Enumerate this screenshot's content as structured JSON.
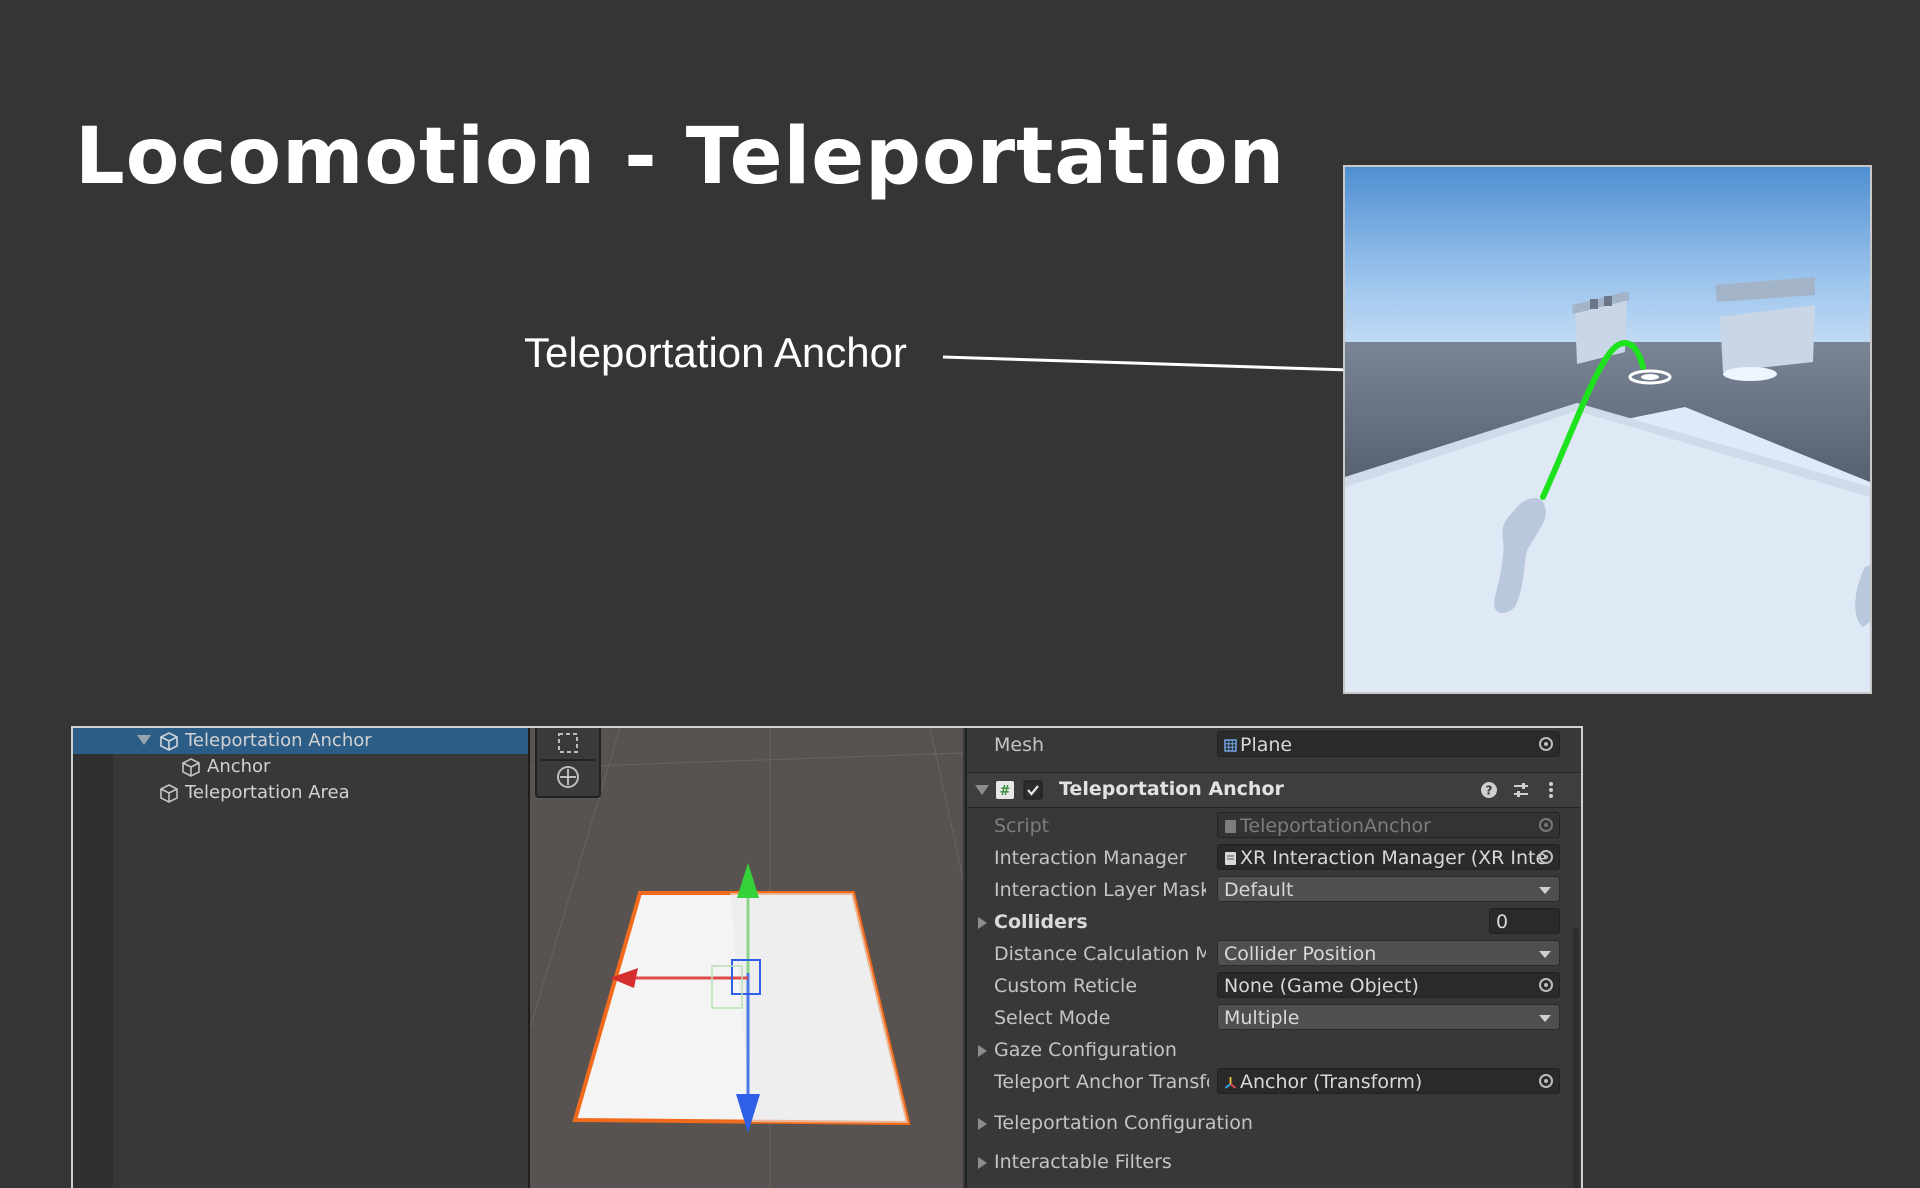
{
  "slide": {
    "title": "Locomotion - Teleportation",
    "callout_label": "Teleportation Anchor"
  },
  "hierarchy": {
    "items": [
      {
        "label": "Teleportation Anchor",
        "selected": true,
        "expanded": true,
        "indent": 0
      },
      {
        "label": "Anchor",
        "selected": false,
        "indent": 1
      },
      {
        "label": "Teleportation Area",
        "selected": false,
        "indent": 0
      }
    ]
  },
  "inspector": {
    "mesh": {
      "label": "Mesh",
      "value": "Plane"
    },
    "component": {
      "name": "Teleportation Anchor",
      "enabled": true
    },
    "fields": {
      "script": {
        "label": "Script",
        "value": "TeleportationAnchor"
      },
      "interaction_manager": {
        "label": "Interaction Manager",
        "value": "XR Interaction Manager (XR Inte"
      },
      "interaction_layer_mask": {
        "label": "Interaction Layer Mask",
        "value": "Default"
      },
      "colliders": {
        "label": "Colliders",
        "value": "0"
      },
      "distance_calc": {
        "label": "Distance Calculation M",
        "value": "Collider Position"
      },
      "custom_reticle": {
        "label": "Custom Reticle",
        "value": "None (Game Object)"
      },
      "select_mode": {
        "label": "Select Mode",
        "value": "Multiple"
      },
      "gaze_configuration": {
        "label": "Gaze Configuration"
      },
      "teleport_anchor_transform": {
        "label": "Teleport Anchor Transfo",
        "value": "Anchor (Transform)"
      },
      "teleportation_configuration": {
        "label": "Teleportation Configuration"
      },
      "interactable_filters": {
        "label": "Interactable Filters"
      }
    }
  },
  "colors": {
    "background": "#353535",
    "selection": "#2c5d87",
    "teleport_ray": "#1ee21e",
    "selected_outline": "#f26a1b"
  }
}
